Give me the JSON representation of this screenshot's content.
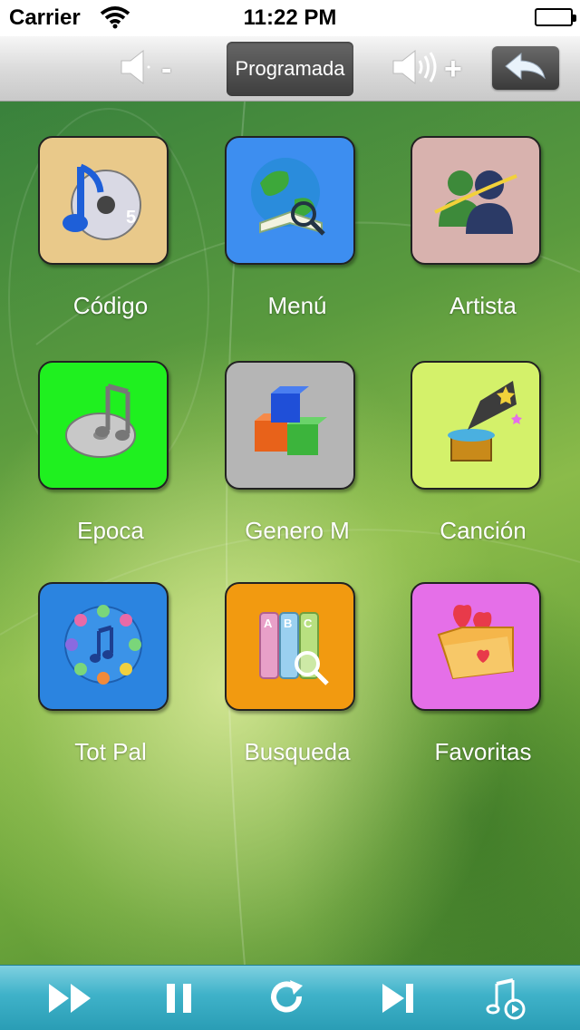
{
  "status_bar": {
    "carrier": "Carrier",
    "time": "11:22 PM",
    "battery_level": 1.0
  },
  "toolbar": {
    "volume_down_sign": "-",
    "mode_label": "Programada",
    "volume_up_sign": "+",
    "back_icon": "back-arrow-icon"
  },
  "grid": [
    {
      "label": "Código",
      "icon": "itunes-music-icon",
      "bg": "#e9c98a"
    },
    {
      "label": "Menú",
      "icon": "globe-book-icon",
      "bg": "#3d8ef0"
    },
    {
      "label": "Artista",
      "icon": "users-icon",
      "bg": "#d8b2ae"
    },
    {
      "label": "Epoca",
      "icon": "music-cd-icon",
      "bg": "#1ff01f"
    },
    {
      "label": "Genero M",
      "icon": "blocks-icon",
      "bg": "#b5b5b5"
    },
    {
      "label": "Canción",
      "icon": "gramophone-icon",
      "bg": "#d4f16a"
    },
    {
      "label": "Tot Pal",
      "icon": "number-clock-icon",
      "bg": "#2b84e0"
    },
    {
      "label": "Busqueda",
      "icon": "abc-search-icon",
      "bg": "#f29a10"
    },
    {
      "label": "Favoritas",
      "icon": "heart-folder-icon",
      "bg": "#e56fe8"
    }
  ],
  "bottom_bar": [
    {
      "name": "fast-forward-icon"
    },
    {
      "name": "pause-icon"
    },
    {
      "name": "repeat-icon"
    },
    {
      "name": "skip-next-icon"
    },
    {
      "name": "music-note-play-icon"
    }
  ]
}
